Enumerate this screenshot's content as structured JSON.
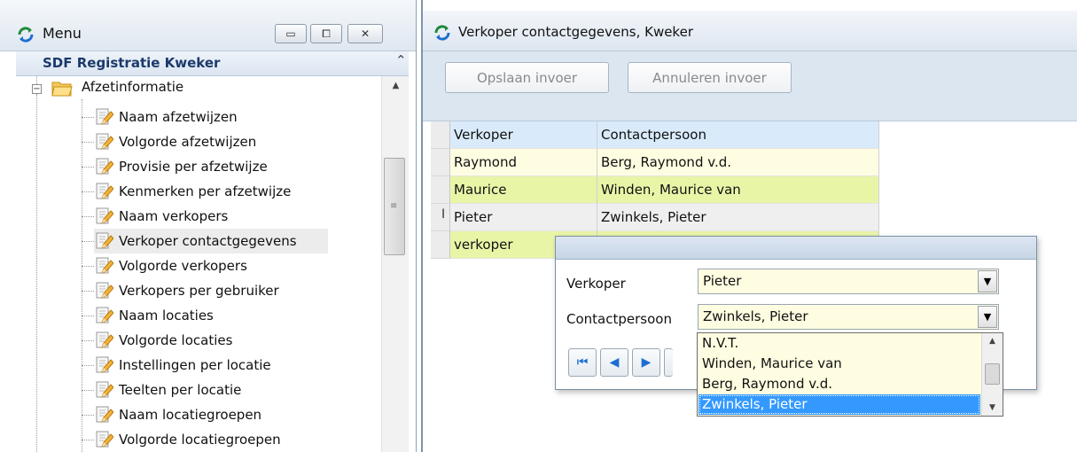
{
  "menu": {
    "title": "Menu",
    "window_buttons": {
      "minimize": "▭",
      "maximize": "⧠",
      "close": "✕"
    },
    "module": "SDF Registratie Kweker",
    "folder": "Afzetinformatie",
    "items": [
      {
        "label": "Naam afzetwijzen"
      },
      {
        "label": "Volgorde afzetwijzen"
      },
      {
        "label": "Provisie per afzetwijze"
      },
      {
        "label": "Kenmerken per afzetwijze"
      },
      {
        "label": "Naam verkopers"
      },
      {
        "label": "Verkoper contactgegevens",
        "selected": true
      },
      {
        "label": "Volgorde verkopers"
      },
      {
        "label": "Verkopers per gebruiker"
      },
      {
        "label": "Naam locaties"
      },
      {
        "label": "Volgorde locaties"
      },
      {
        "label": "Instellingen per locatie"
      },
      {
        "label": "Teelten per locatie"
      },
      {
        "label": "Naam locatiegroepen"
      },
      {
        "label": "Volgorde locatiegroepen"
      }
    ]
  },
  "form": {
    "title": "Verkoper contactgegevens, Kweker",
    "toolbar": {
      "save_label": "Opslaan invoer",
      "cancel_label": "Annuleren invoer"
    },
    "grid": {
      "columns": [
        "Verkoper",
        "Contactpersoon"
      ],
      "rows": [
        {
          "verkoper": "Raymond",
          "contactpersoon": "Berg, Raymond v.d.",
          "bg": "#fffde1"
        },
        {
          "verkoper": "Maurice",
          "contactpersoon": "Winden, Maurice van",
          "bg": "#e8f5a7"
        },
        {
          "verkoper": "Pieter",
          "contactpersoon": "Zwinkels, Pieter",
          "bg": "#efefef",
          "current": true
        },
        {
          "verkoper": "verkoper",
          "contactpersoon": "",
          "bg": "#e8f5a7"
        }
      ],
      "row_cursor": "I"
    }
  },
  "popup": {
    "verkoper_label": "Verkoper",
    "verkoper_value": "Pieter",
    "contactpersoon_label": "Contactpersoon",
    "contactpersoon_value": "Zwinkels, Pieter",
    "nav": {
      "first": "⏮",
      "prev": "◀",
      "next": "▶"
    },
    "dropdown_options": [
      {
        "label": "N.V.T."
      },
      {
        "label": "Winden, Maurice van"
      },
      {
        "label": "Berg, Raymond v.d."
      },
      {
        "label": "Zwinkels, Pieter",
        "selected": true
      }
    ]
  },
  "colors": {
    "accent_blue": "#3399ff",
    "module_text": "#1b3a6b",
    "field_bg": "#fffde1",
    "row_alt_bg": "#e8f5a7"
  },
  "icons": {
    "app": "sync-arrows-icon",
    "folder": "open-folder-icon",
    "tree_item": "edit-document-icon"
  }
}
